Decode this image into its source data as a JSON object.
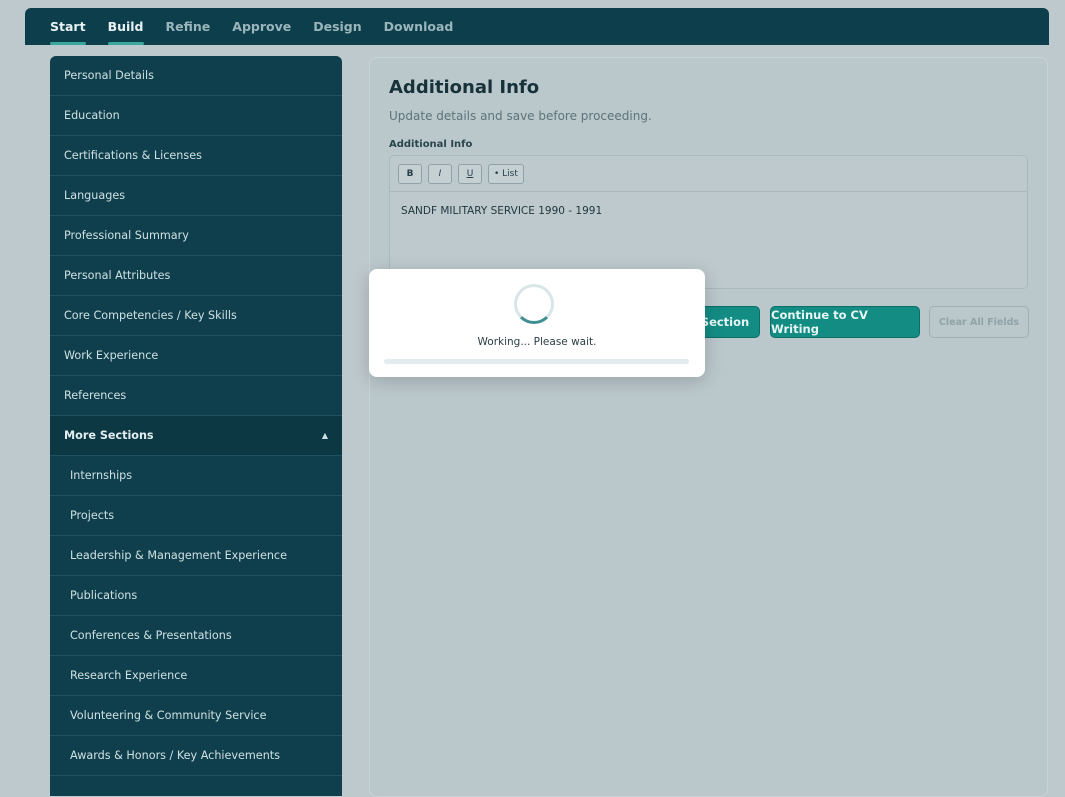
{
  "nav": {
    "tabs": [
      {
        "label": "Start"
      },
      {
        "label": "Build"
      },
      {
        "label": "Refine"
      },
      {
        "label": "Approve"
      },
      {
        "label": "Design"
      },
      {
        "label": "Download"
      }
    ],
    "active_tabs": [
      "Start",
      "Build"
    ]
  },
  "sidebar": {
    "items": [
      "Personal Details",
      "Education",
      "Certifications & Licenses",
      "Languages",
      "Professional Summary",
      "Personal Attributes",
      "Core Competencies / Key Skills",
      "Work Experience",
      "References"
    ],
    "group": {
      "label": "More Sections",
      "icon": "chevron-up-icon",
      "items": [
        "Internships",
        "Projects",
        "Leadership & Management Experience",
        "Publications",
        "Conferences & Presentations",
        "Research Experience",
        "Volunteering & Community Service",
        "Awards & Honors / Key Achievements"
      ]
    }
  },
  "main": {
    "title": "Additional Info",
    "subtitle": "Update details and save before proceeding.",
    "field_label": "Additional Info",
    "toolbar": {
      "bold": "B",
      "italic": "I",
      "underline": "U",
      "list": "• List"
    },
    "editor_text": "SANDF MILITARY SERVICE 1990 - 1991",
    "buttons": {
      "save_partial": "Section",
      "continue": "Continue to CV Writing",
      "clear": "Clear All Fields"
    }
  },
  "modal": {
    "message": "Working... Please wait.",
    "progress": 0
  },
  "colors": {
    "nav_bg": "#0d3e4b",
    "sidebar_bg": "#0f3f4c",
    "accent": "#138c84",
    "active_underline": "#3aa89c",
    "overlay_bg": "#bec9cd"
  }
}
